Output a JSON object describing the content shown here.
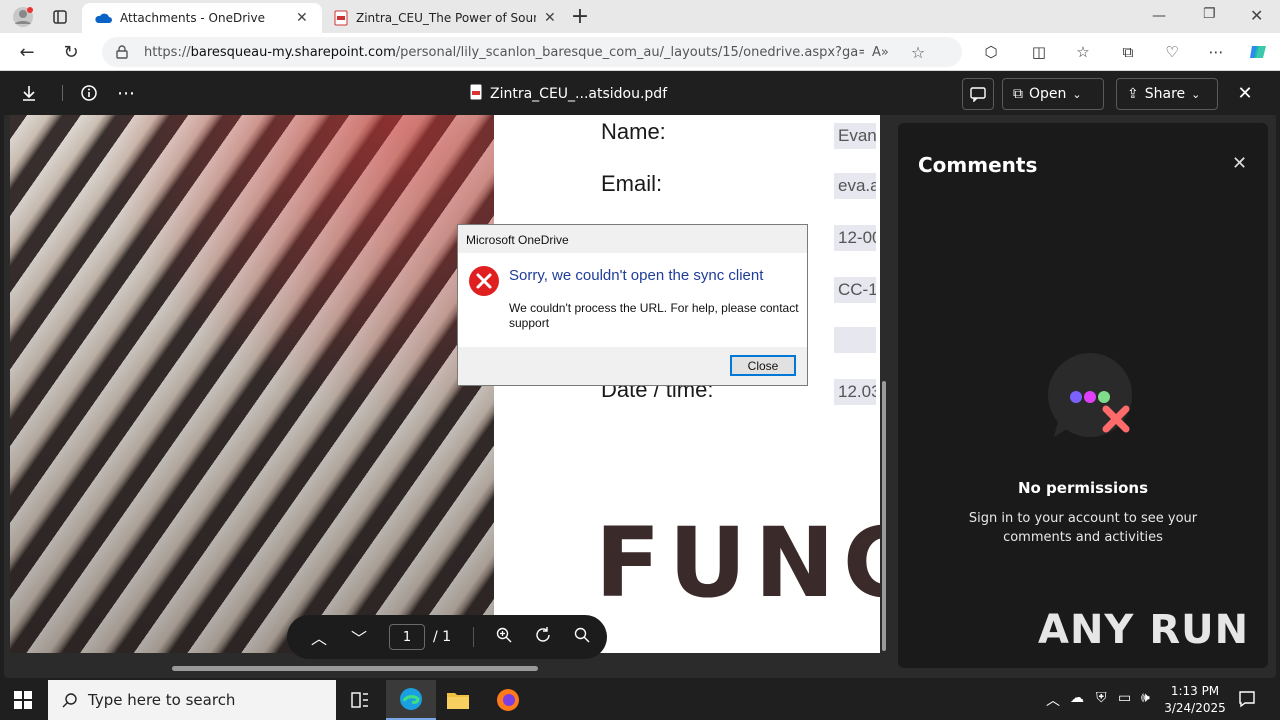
{
  "browser": {
    "tabs": [
      {
        "label": "Attachments - OneDrive",
        "active": true
      },
      {
        "label": "Zintra_CEU_The Power of Sound...",
        "active": false
      }
    ],
    "new_tab": "+",
    "url_scheme": "https://",
    "url_host": "baresqueau-my.sharepoint.com",
    "url_path": "/personal/lily_scanlon_baresque_com_au/_layouts/15/onedrive.aspx?ga=1&id=..."
  },
  "viewer": {
    "file_name": "Zintra_CEU_...atsidou.pdf",
    "open_label": "Open",
    "share_label": "Share",
    "page_current": "1",
    "page_total": "/ 1"
  },
  "document": {
    "labels": [
      "Name:",
      "Email:",
      "Date / time:"
    ],
    "values": [
      "Evange",
      "eva.a",
      "12-00",
      "CC-1",
      "",
      "12.03"
    ],
    "logo": "FUNC"
  },
  "comments": {
    "title": "Comments",
    "status_title": "No permissions",
    "status_text": "Sign in to your account to see your comments and activities"
  },
  "dialog": {
    "title": "Microsoft OneDrive",
    "heading": "Sorry, we couldn't open the sync client",
    "message": "We couldn't process the URL. For help, please contact support",
    "close_label": "Close"
  },
  "watermark": "ANY RUN",
  "taskbar": {
    "search_placeholder": "Type here to search",
    "time": "1:13 PM",
    "date": "3/24/2025"
  },
  "colors": {
    "dialog_heading": "#1f3d99",
    "error_red": "#e02020",
    "accent": "#0078d7"
  }
}
